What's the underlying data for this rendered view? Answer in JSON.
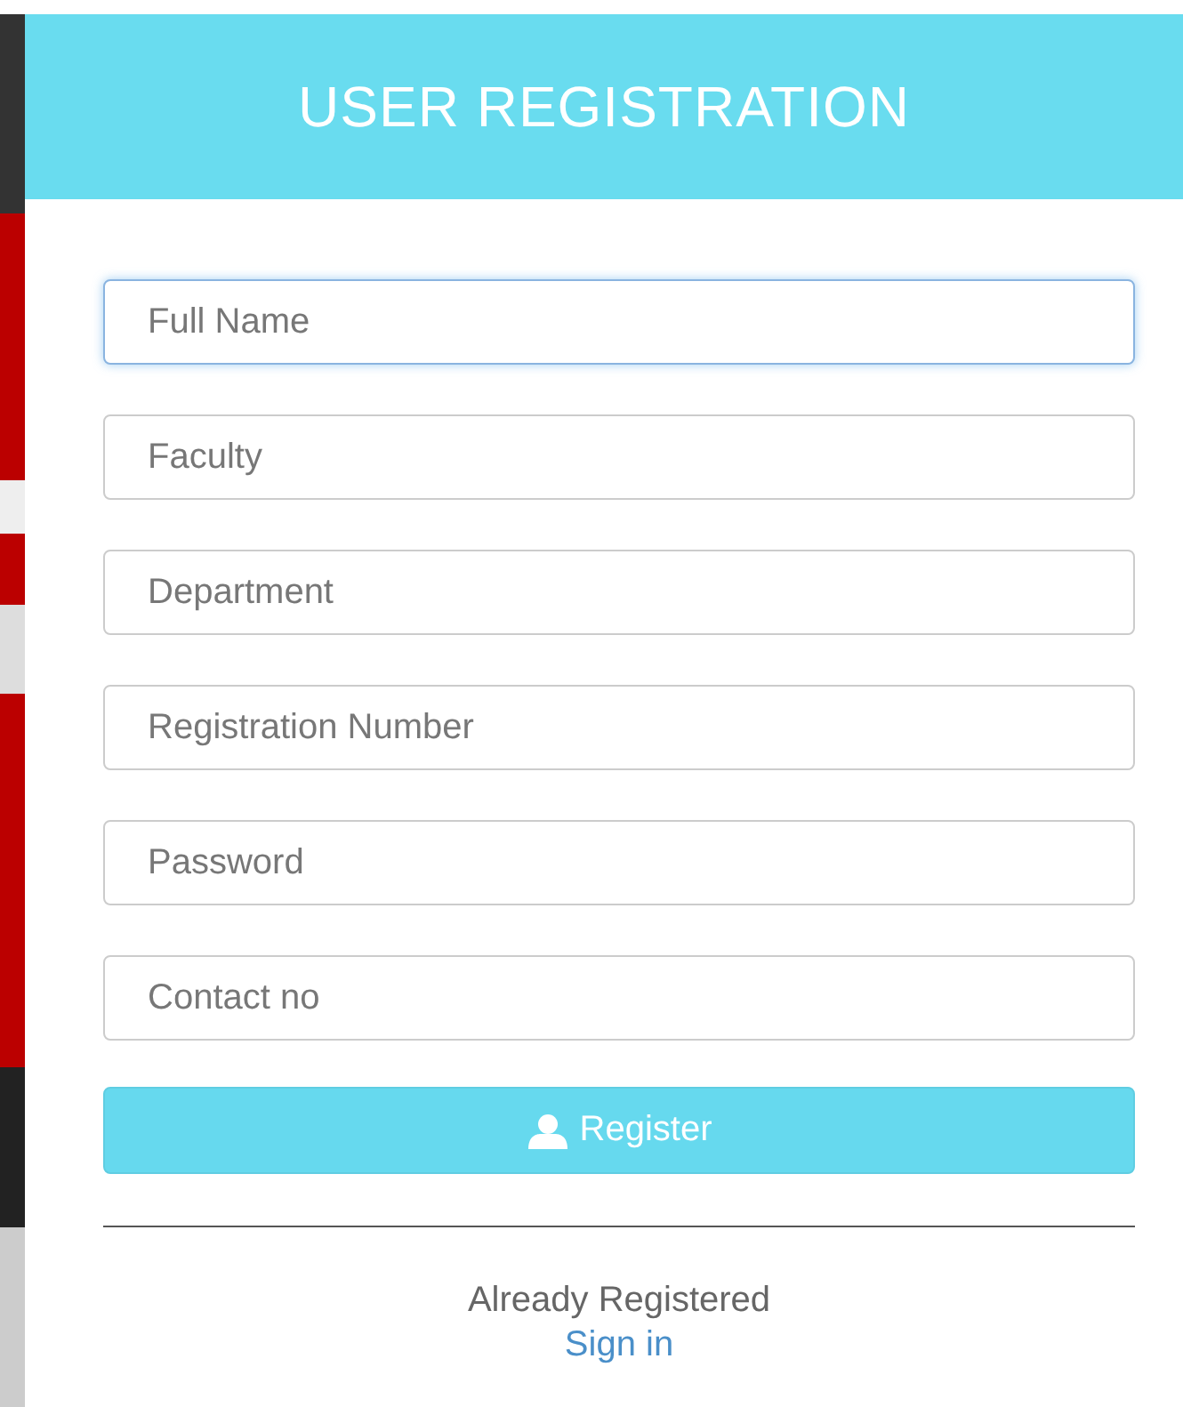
{
  "header": {
    "title": "USER REGISTRATION"
  },
  "fields": [
    {
      "placeholder": "Full Name",
      "focused": true
    },
    {
      "placeholder": "Faculty",
      "focused": false
    },
    {
      "placeholder": "Department",
      "focused": false
    },
    {
      "placeholder": "Registration Number",
      "focused": false
    },
    {
      "placeholder": "Password",
      "focused": false
    },
    {
      "placeholder": "Contact no",
      "focused": false
    }
  ],
  "register_button": {
    "label": "Register"
  },
  "footer": {
    "text": "Already Registered",
    "link": "Sign in"
  }
}
